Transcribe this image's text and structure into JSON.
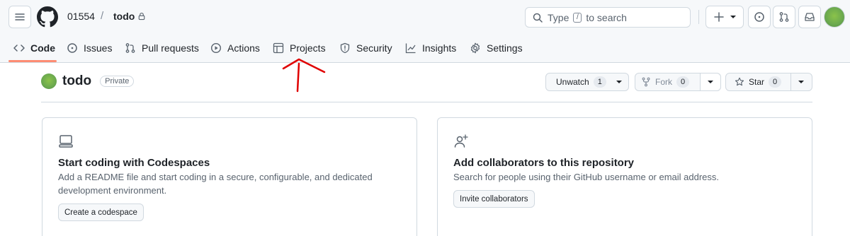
{
  "header": {
    "owner": "01554",
    "separator": "/",
    "repo": "todo",
    "search_label": "Type",
    "search_key": "/",
    "search_suffix": "to search"
  },
  "nav_tabs": [
    {
      "label": "Code",
      "icon": "code-icon",
      "active": true
    },
    {
      "label": "Issues",
      "icon": "issue-icon"
    },
    {
      "label": "Pull requests",
      "icon": "pull-request-icon"
    },
    {
      "label": "Actions",
      "icon": "play-icon"
    },
    {
      "label": "Projects",
      "icon": "table-icon"
    },
    {
      "label": "Security",
      "icon": "shield-icon"
    },
    {
      "label": "Insights",
      "icon": "graph-icon"
    },
    {
      "label": "Settings",
      "icon": "gear-icon"
    }
  ],
  "repo": {
    "name": "todo",
    "visibility": "Private",
    "unwatch_label": "Unwatch",
    "watch_count": "1",
    "fork_label": "Fork",
    "fork_count": "0",
    "star_label": "Star",
    "star_count": "0"
  },
  "cards": {
    "codespaces": {
      "title": "Start coding with Codespaces",
      "description": "Add a README file and start coding in a secure, configurable, and dedicated development environment.",
      "button": "Create a codespace"
    },
    "collaborators": {
      "title": "Add collaborators to this repository",
      "description": "Search for people using their GitHub username or email address.",
      "button": "Invite collaborators"
    }
  },
  "colors": {
    "accent_underline": "#fd8c73",
    "annotation_arrow": "#e00000"
  }
}
